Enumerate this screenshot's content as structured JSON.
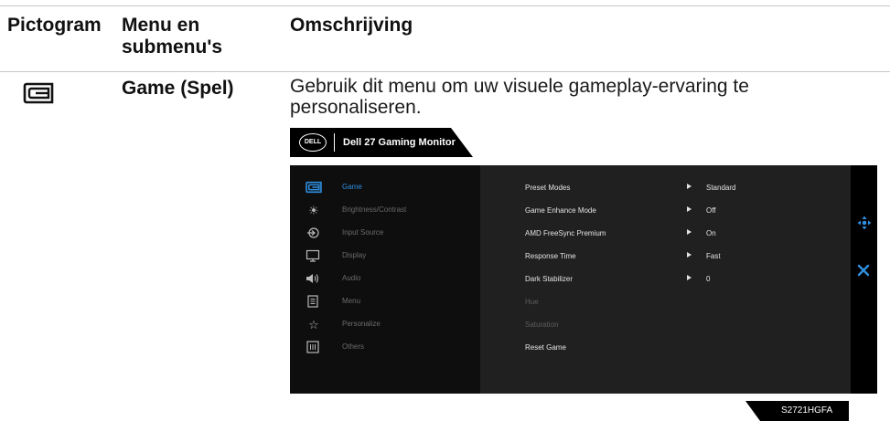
{
  "table": {
    "headers": [
      "Pictogram",
      "Menu en submenu's",
      "Omschrijving"
    ],
    "row": {
      "pictogram_icon": "game-icon",
      "menu_name": "Game (Spel)",
      "description": "Gebruik dit menu om uw visuele gameplay-ervaring te personaliseren."
    }
  },
  "osd": {
    "brand_logo_text": "DELL",
    "brand_title": "Dell 27 Gaming Monitor",
    "model": "S2721HGFA",
    "accent_color": "#2f8fe0",
    "nav_items": [
      {
        "label": "Game",
        "icon": "game-icon",
        "active": true
      },
      {
        "label": "Brightness/Contrast",
        "icon": "brightness-icon",
        "active": false
      },
      {
        "label": "Input Source",
        "icon": "input-source-icon",
        "active": false
      },
      {
        "label": "Display",
        "icon": "display-icon",
        "active": false
      },
      {
        "label": "Audio",
        "icon": "audio-icon",
        "active": false
      },
      {
        "label": "Menu",
        "icon": "menu-icon",
        "active": false
      },
      {
        "label": "Personalize",
        "icon": "star-icon",
        "active": false
      },
      {
        "label": "Others",
        "icon": "others-icon",
        "active": false
      }
    ],
    "menu_rows": [
      {
        "label": "Preset Modes",
        "value": "Standard",
        "arrow": true,
        "enabled": true
      },
      {
        "label": "Game Enhance Mode",
        "value": "Off",
        "arrow": true,
        "enabled": true
      },
      {
        "label": "AMD FreeSync Premium",
        "value": "On",
        "arrow": true,
        "enabled": true
      },
      {
        "label": "Response Time",
        "value": "Fast",
        "arrow": true,
        "enabled": true
      },
      {
        "label": "Dark Stabilizer",
        "value": "0",
        "arrow": true,
        "enabled": true
      },
      {
        "label": "Hue",
        "value": "",
        "arrow": false,
        "enabled": false
      },
      {
        "label": "Saturation",
        "value": "",
        "arrow": false,
        "enabled": false
      },
      {
        "label": "Reset Game",
        "value": "",
        "arrow": false,
        "enabled": true
      }
    ],
    "controls": [
      "move-joystick-icon",
      "close-icon"
    ]
  }
}
